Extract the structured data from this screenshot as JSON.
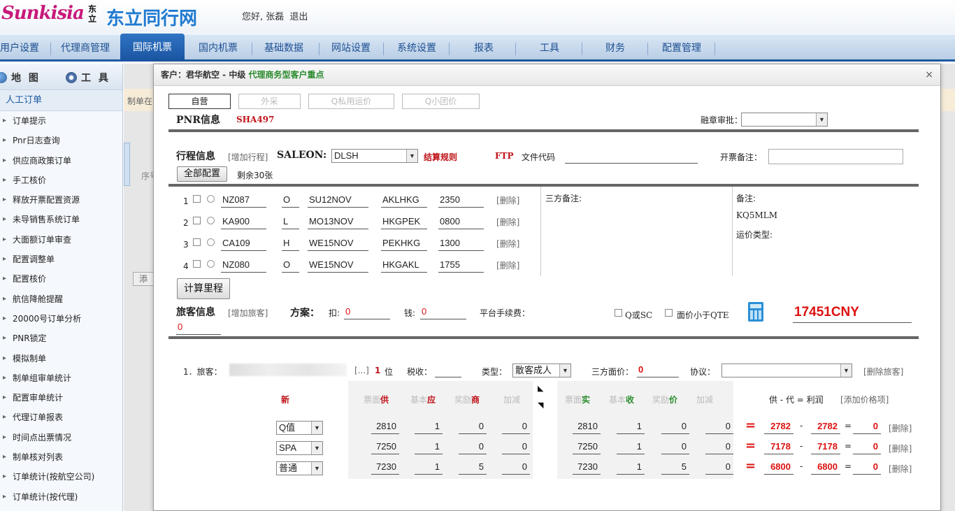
{
  "header": {
    "logo_script": "Sunkisia",
    "logo_small": "东立",
    "brand": "东立同行网",
    "greeting": "您好, 张磊",
    "logout": "退出"
  },
  "nav": [
    {
      "label": "用户设置"
    },
    {
      "label": "代理商管理"
    },
    {
      "label": "国际机票"
    },
    {
      "label": "国内机票"
    },
    {
      "label": "基础数据"
    },
    {
      "label": "网站设置"
    },
    {
      "label": "系统设置"
    },
    {
      "label": "报表"
    },
    {
      "label": "工具"
    },
    {
      "label": "财务"
    },
    {
      "label": "配置管理"
    }
  ],
  "sidebar": {
    "tab_map": "地 图",
    "tab_tools": "工 具",
    "header": "人工订单",
    "items": [
      "订单提示",
      "Pnr日志查询",
      "供应商政策订单",
      "手工核价",
      "释放开票配置资源",
      "未导销售系统订单",
      "大面额订单审查",
      "配置调整单",
      "配置核价",
      "航信降舱提醒",
      "20000号订单分析",
      "PNR锁定",
      "模拟制单",
      "制单组审单统计",
      "配置审单统计",
      "代理订单报表",
      "时间点出票情况",
      "制单核对列表",
      "订单统计(按航空公司)",
      "订单统计(按代理)"
    ]
  },
  "background": {
    "text1": "制单在",
    "text2": "序号",
    "btn": "添"
  },
  "modal": {
    "title_prefix": "客户：君华航空 - 中级",
    "title_highlight": "代理商务型客户重点",
    "close": "×",
    "tabs": [
      "自营",
      "外采",
      "Q私用运价",
      "Q小团价"
    ],
    "pnr_label": "PNR信息",
    "pnr_code": "SHA497",
    "approve_label": "融章审批：",
    "approve_value": "",
    "trip_label": "行程信息",
    "add_trip": "[增加行程]",
    "saleon_label": "SALEON:",
    "saleon_value": "DLSH",
    "settle_rule": "结算规则",
    "ftp_label": "FTP",
    "file_code_label": "文件代码",
    "file_code_value": "",
    "ticket_note_label": "开票备注：",
    "ticket_note_value": "",
    "all_config_btn": "全部配置",
    "remaining": "剩余30张",
    "segments": [
      {
        "no": "1",
        "flight": "NZ087",
        "cls": "O",
        "date": "SU12NOV",
        "route": "AKLHKG",
        "time": "2350",
        "del": "[删除]"
      },
      {
        "no": "2",
        "flight": "KA900",
        "cls": "L",
        "date": "MO13NOV",
        "route": "HKGPEK",
        "time": "0800",
        "del": "[删除]"
      },
      {
        "no": "3",
        "flight": "CA109",
        "cls": "H",
        "date": "WE15NOV",
        "route": "PEKHKG",
        "time": "1300",
        "del": "[删除]"
      },
      {
        "no": "4",
        "flight": "NZ080",
        "cls": "O",
        "date": "WE15NOV",
        "route": "HKGAKL",
        "time": "1755",
        "del": "[删除]"
      }
    ],
    "third_party_note_label": "三方备注:",
    "note_label": "备注:",
    "note_value": "KQ5MLM",
    "fare_type_label": "运价类型:",
    "calc_btn": "计算里程",
    "pax_label": "旅客信息",
    "add_pax": "[增加旅客]",
    "plan_label": "方案：",
    "kou_label": "扣:",
    "kou_value": "0",
    "qian_label": "钱:",
    "qian_value": "0",
    "platform_fee_label": "平台手续费：",
    "platform_fee_value": "0",
    "q_or_sc": "Q或SC",
    "face_lt_qte": "面价小于QTE",
    "total": "17451CNY",
    "pax_row": {
      "prefix": "1．旅客：",
      "ellipsis": "[...]",
      "count": "1",
      "count_unit": "位",
      "tax_label": "税收：",
      "tax_value": "",
      "type_label": "类型：",
      "type_value": "散客成人",
      "tri_face_label": "三方面价：",
      "tri_face_value": "0",
      "protocol_label": "协议：",
      "protocol_value": "",
      "del_pax": "[删除旅客]"
    },
    "fee_headers": {
      "new": "新",
      "supply": [
        "票面",
        "供",
        "基本",
        "应",
        "奖励",
        "商",
        "加减"
      ],
      "actual": [
        "票面",
        "实",
        "基本",
        "收",
        "奖励",
        "价",
        "加减"
      ],
      "formula": "供 - 代 = 利润",
      "add_price": "[添加价格项]"
    },
    "fee_rows": [
      {
        "type": "Q值",
        "s1": "2810",
        "s2": "1",
        "s3": "0",
        "s4": "0",
        "a1": "2810",
        "a2": "1",
        "a3": "0",
        "a4": "0",
        "supply": "2782",
        "agent": "2782",
        "profit": "0",
        "del": "[删除]"
      },
      {
        "type": "SPA",
        "s1": "7250",
        "s2": "1",
        "s3": "0",
        "s4": "0",
        "a1": "7250",
        "a2": "1",
        "a3": "0",
        "a4": "0",
        "supply": "7178",
        "agent": "7178",
        "profit": "0",
        "del": "[删除]"
      },
      {
        "type": "普通",
        "s1": "7230",
        "s2": "1",
        "s3": "5",
        "s4": "0",
        "a1": "7230",
        "a2": "1",
        "a3": "5",
        "a4": "0",
        "supply": "6800",
        "agent": "6800",
        "profit": "0",
        "del": "[删除]"
      }
    ],
    "symbols": {
      "eq": "=",
      "minus": "-"
    }
  }
}
